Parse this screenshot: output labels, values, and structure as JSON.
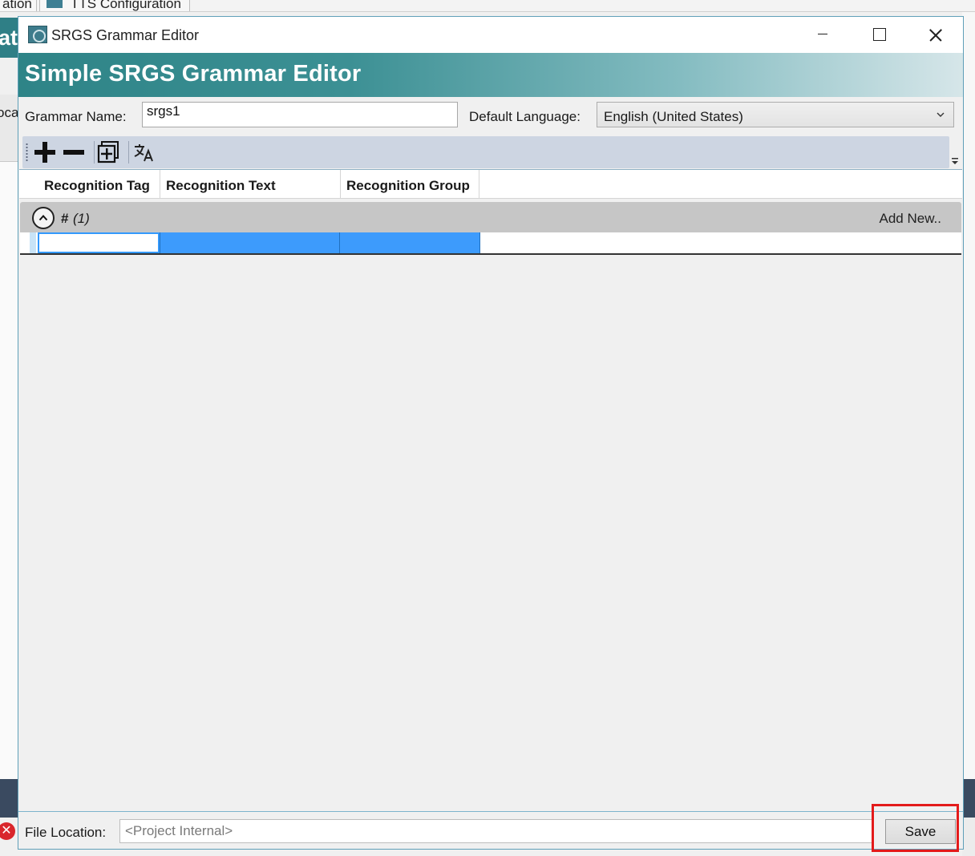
{
  "background": {
    "tab_1_label": "ation",
    "tab_2_label": "TTS Configuration",
    "left_header_fragment": "ati",
    "left_field_fragment": "ocal"
  },
  "window": {
    "title": "SRGS Grammar Editor",
    "icon": "app-icon"
  },
  "banner": {
    "title": "Simple SRGS Grammar Editor"
  },
  "form": {
    "grammar_name_label": "Grammar Name:",
    "grammar_name_value": "srgs1",
    "default_language_label": "Default Language:",
    "default_language_value": "English (United States)"
  },
  "toolbar": {
    "buttons": [
      "add-icon",
      "remove-icon",
      "copy-icon",
      "translate-icon"
    ]
  },
  "grid": {
    "columns": [
      "Recognition Tag",
      "Recognition Text",
      "Recognition Group"
    ],
    "group": {
      "hash": "#",
      "count": "(1)",
      "add_new_label": "Add New.."
    },
    "rows": [
      {
        "tag": "",
        "text": "",
        "group": ""
      }
    ]
  },
  "footer": {
    "file_location_label": "File Location:",
    "file_location_placeholder": "<Project Internal>",
    "save_label": "Save"
  },
  "colors": {
    "banner_start": "#2e8487",
    "selection": "#3d9bfc",
    "highlight_box": "#e31b1b",
    "error_icon": "#d9262c"
  }
}
